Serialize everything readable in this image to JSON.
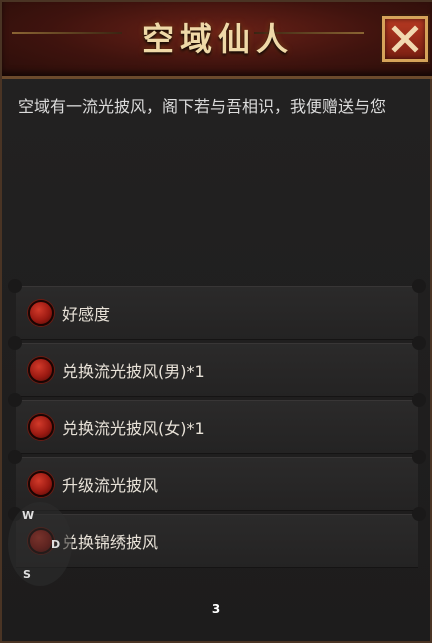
{
  "window": {
    "title": "空域仙人",
    "close_label": "close"
  },
  "dialog": {
    "text": "空域有一流光披风，阁下若与吾相识，我便赠送与您"
  },
  "options": [
    {
      "label": "好感度"
    },
    {
      "label": "兑换流光披风(男)*1"
    },
    {
      "label": "兑换流光披风(女)*1"
    },
    {
      "label": "升级流光披风"
    },
    {
      "label": "兑换锦绣披风"
    }
  ],
  "minimap": {
    "compass": [
      "W",
      "D",
      "S"
    ]
  },
  "footer": {
    "page_number": "3"
  },
  "colors": {
    "title_bar": "#5a1b12",
    "title_text": "#efd9a8",
    "close_button": "#a8301d",
    "bullet": "#b0241a",
    "panel": "#1f1e1e"
  },
  "icons": {
    "close": "close-x-icon",
    "bullet": "red-orb-icon"
  }
}
